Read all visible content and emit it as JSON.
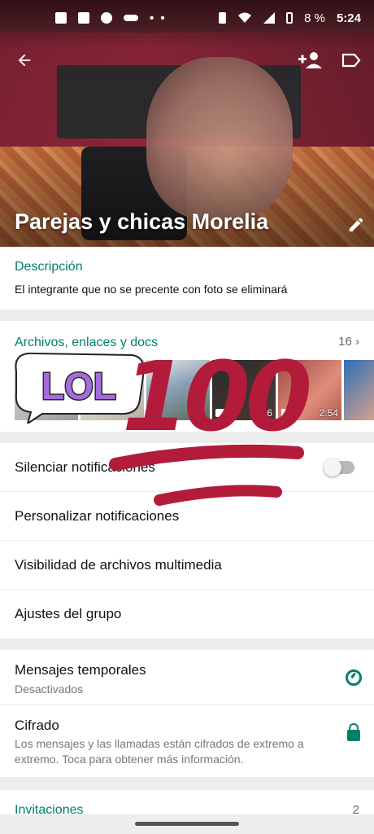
{
  "status_bar": {
    "battery": "8 %",
    "time": "5:24",
    "dots": "• •"
  },
  "header": {
    "group_name": "Parejas y chicas Morelia",
    "icons": [
      "back-arrow-icon",
      "add-participant-icon",
      "label-icon",
      "pencil-icon"
    ]
  },
  "description": {
    "heading": "Descripción",
    "text": "El integrante que no se precente con foto se eliminará"
  },
  "media": {
    "heading": "Archivos, enlaces y docs",
    "count": "16",
    "thumbnails": [
      {
        "kind": "image"
      },
      {
        "kind": "image"
      },
      {
        "kind": "image"
      },
      {
        "kind": "video",
        "duration": "1:16"
      },
      {
        "kind": "video",
        "duration": "2:54"
      },
      {
        "kind": "image"
      }
    ]
  },
  "settings": {
    "mute": "Silenciar notificaciones",
    "custom": "Personalizar notificaciones",
    "media_visibility": "Visibilidad de archivos multimedia",
    "group_settings": "Ajustes del grupo",
    "mute_enabled": false
  },
  "security": {
    "temp_title": "Mensajes temporales",
    "temp_sub": "Desactivados",
    "crypto_title": "Cifrado",
    "crypto_sub": "Los mensajes y las llamadas están cifrados de extremo a extremo. Toca para obtener más información."
  },
  "invites": {
    "label": "Invitaciones",
    "count": "2"
  },
  "stickers": {
    "lol_text": "LOL",
    "hundred_text": "100"
  },
  "colors": {
    "accent": "#008069",
    "sticker_red": "#b31b3a",
    "lol_purple": "#a66bdc",
    "lol_green": "#7bd07a"
  }
}
